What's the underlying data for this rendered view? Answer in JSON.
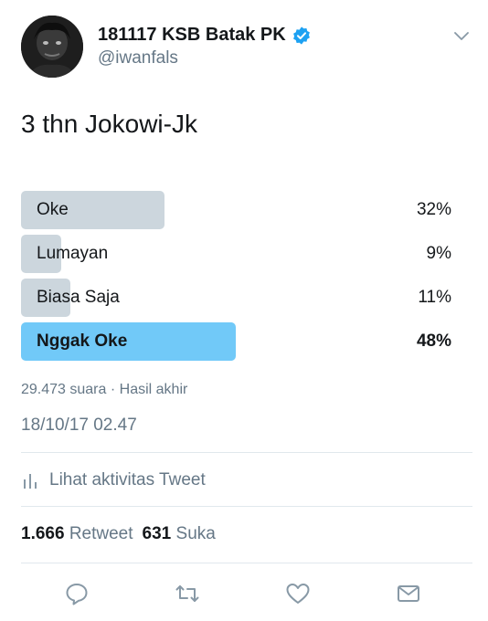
{
  "author": {
    "display_name": "181117 KSB Batak PK",
    "handle": "@iwanfals",
    "verified": true
  },
  "tweet": {
    "text": "3 thn Jokowi-Jk"
  },
  "poll": {
    "options": [
      {
        "label": "Oke",
        "percent_text": "32%",
        "percent": 32,
        "winner": false
      },
      {
        "label": "Lumayan",
        "percent_text": "9%",
        "percent": 9,
        "winner": false
      },
      {
        "label": "Biasa Saja",
        "percent_text": "11%",
        "percent": 11,
        "winner": false
      },
      {
        "label": "Nggak Oke",
        "percent_text": "48%",
        "percent": 48,
        "winner": true
      }
    ],
    "votes": "29.473 suara",
    "separator": "·",
    "status": "Hasil akhir"
  },
  "timestamp": "18/10/17 02.47",
  "activity": {
    "label": "Lihat aktivitas Tweet"
  },
  "stats": {
    "retweets": "1.666",
    "retweets_label": "Retweet",
    "likes": "631",
    "likes_label": "Suka"
  },
  "actions": [
    {
      "name": "reply-icon"
    },
    {
      "name": "retweet-icon"
    },
    {
      "name": "like-icon"
    },
    {
      "name": "direct-message-icon"
    }
  ],
  "colors": {
    "accent": "#1da1f2",
    "winner_bar": "#71c9f8",
    "bar": "#ccd6dd",
    "secondary_text": "#657786",
    "icon": "#8899a6",
    "divider": "#e1e8ed"
  }
}
